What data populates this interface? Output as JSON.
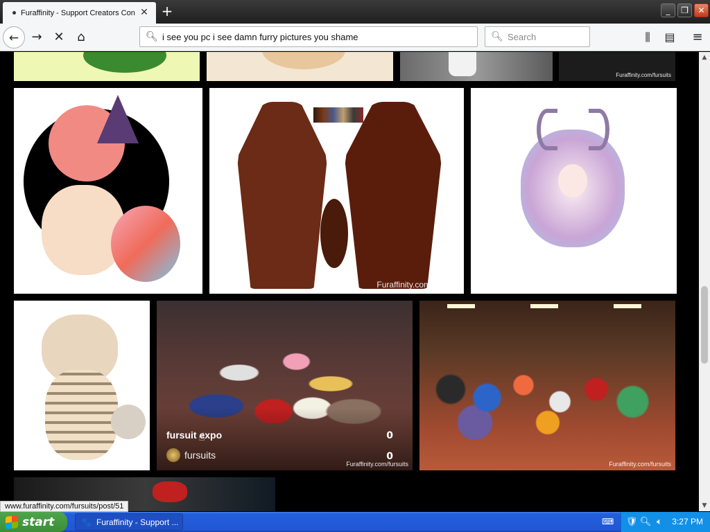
{
  "tab": {
    "title": "Furaffinity - Support Creators Con",
    "close": "✕"
  },
  "newtab": "+",
  "window": {
    "minimize": "_",
    "maximize": "❐",
    "close": "✕"
  },
  "nav": {
    "back": "←",
    "forward": "→",
    "stop": "✕",
    "home": "⌂",
    "library": "⫼",
    "sidebar": "▤",
    "menu": "≡"
  },
  "url": {
    "value": "i see you pc i see damn furry pictures you shame",
    "icon": "search-icon"
  },
  "search": {
    "placeholder": "Search",
    "icon": "search-icon"
  },
  "overlay": {
    "title": "fursuit expo",
    "user": "fursuits",
    "count1": "0",
    "count2": "0"
  },
  "watermarks": {
    "ref": "Furaffinity.com/fursuits",
    "expo": "Furaffinity.com/fursuits",
    "group": "Furaffinity.com/fursuits",
    "top": "Furaffinity.com/fursuits"
  },
  "status_link": "www.furaffinity.com/fursuits/post/51",
  "taskbar": {
    "start": "start",
    "window": "Furaffinity - Support ...",
    "clock": "3:27 PM"
  },
  "colors": {
    "accent": "#2157d4",
    "start": "#3c8d38"
  }
}
